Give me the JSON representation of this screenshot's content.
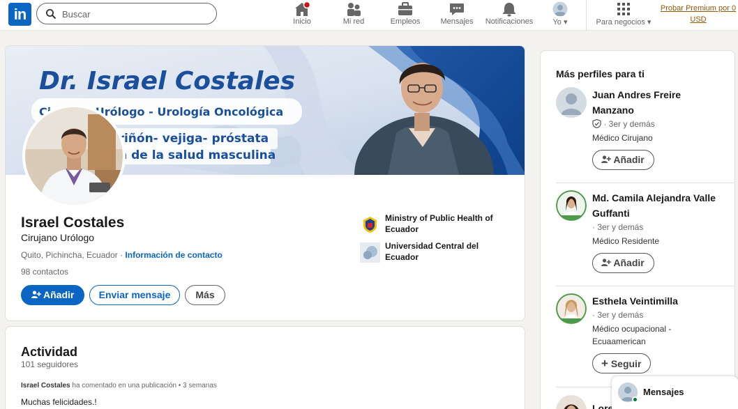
{
  "nav": {
    "logo": "in",
    "search_placeholder": "Buscar",
    "items": [
      {
        "label": "Inicio",
        "icon": "home-icon"
      },
      {
        "label": "Mi red",
        "icon": "network-icon"
      },
      {
        "label": "Empleos",
        "icon": "briefcase-icon"
      },
      {
        "label": "Mensajes",
        "icon": "chat-icon"
      },
      {
        "label": "Notificaciones",
        "icon": "bell-icon"
      },
      {
        "label": "Yo",
        "icon": "avatar"
      },
      {
        "label": "Para negocios",
        "icon": "grid-icon"
      }
    ],
    "premium": "Probar Premium por 0 USD"
  },
  "banner": {
    "title": "Dr. Israel Costales",
    "line1": "Cirujano Urólogo  -  Urología Oncológica",
    "line2": "Cáncer de riñón- vejiga- próstata",
    "line3": "Especialista de la salud masculina"
  },
  "profile": {
    "name": "Israel Costales",
    "headline": "Cirujano Urólogo",
    "location": "Quito, Pichincha, Ecuador",
    "separator": " · ",
    "contact_link": "Información de contacto",
    "connections": "98 contactos",
    "add_button": "Añadir",
    "message_button": "Enviar mensaje",
    "more_button": "Más",
    "orgs": [
      {
        "name": "Ministry of Public Health of Ecuador"
      },
      {
        "name": "Universidad Central del Ecuador"
      }
    ]
  },
  "activity": {
    "title": "Actividad",
    "followers": "101 seguidores",
    "meta_name": "Israel Costales",
    "meta_text": " ha comentado en una publicación • 3 semanas",
    "text": "Muchas felicidades.!"
  },
  "sidebar": {
    "title": "Más perfiles para ti",
    "people": [
      {
        "name": "Juan Andres Freire Manzano",
        "degree": "· 3er y demás",
        "desc": "Médico Cirujano",
        "button": "Añadir",
        "verified": true
      },
      {
        "name": "Md. Camila Alejandra Valle Guffanti",
        "degree": "· 3er y demás",
        "desc": "Médico Residente",
        "button": "Añadir"
      },
      {
        "name": "Esthela Veintimilla",
        "degree": "· 3er y demás",
        "desc": "Médico ocupacional - Ecuaamerican",
        "button": "Seguir"
      },
      {
        "name": "Lore"
      }
    ]
  },
  "messaging": {
    "label": "Mensajes"
  },
  "colors": {
    "brand": "#0a66c2",
    "premium": "#915907",
    "online": "#057642"
  }
}
